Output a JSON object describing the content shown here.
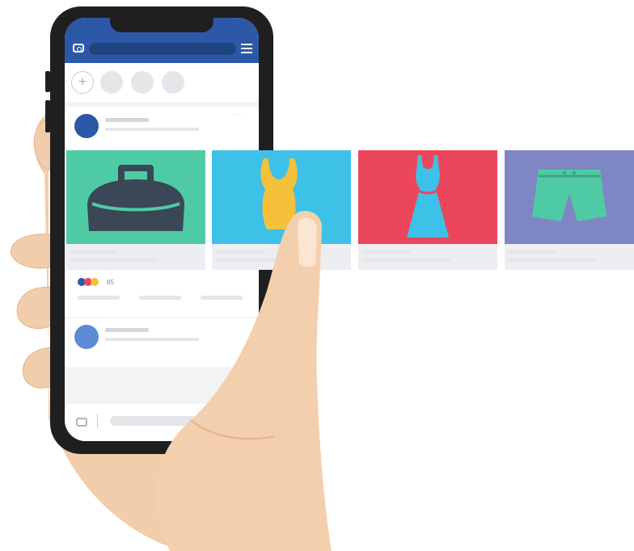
{
  "post": {
    "reaction_count": "85"
  },
  "colors": {
    "phone_frame": "#1f1f1f",
    "header_blue": "#2c58a7",
    "card_green": "#4ecba5",
    "card_blue": "#3ec1e6",
    "card_red": "#ec465c",
    "card_purple": "#7f86c4",
    "skin": "#f4cfae",
    "skin_shade": "#e2b38e"
  },
  "icons": {
    "header_left": "camera-icon",
    "header_right": "menu-icon",
    "card_1": "bag-icon",
    "card_2": "swimsuit-icon",
    "card_3": "dress-icon",
    "card_4": "shorts-icon"
  }
}
